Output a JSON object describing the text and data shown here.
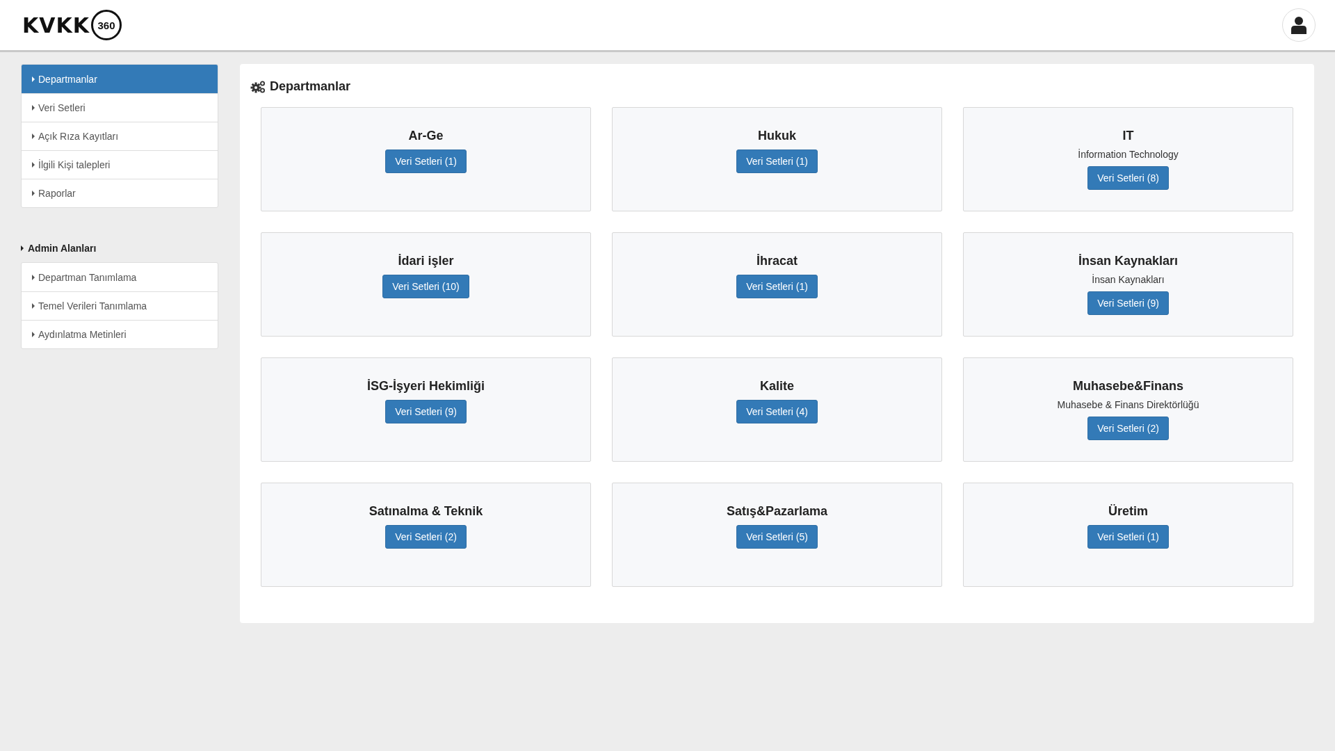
{
  "header": {
    "logo_text": "KVKK",
    "logo_number": "360"
  },
  "sidebar": {
    "items": [
      {
        "label": "Departmanlar",
        "selected": true
      },
      {
        "label": "Veri Setleri",
        "selected": false
      },
      {
        "label": "Açık Rıza Kayıtları",
        "selected": false
      },
      {
        "label": "İlgili Kişi talepleri",
        "selected": false
      },
      {
        "label": "Raporlar",
        "selected": false
      }
    ],
    "admin_title": "Admin Alanları",
    "admin_items": [
      {
        "label": "Departman Tanımlama",
        "selected": false
      },
      {
        "label": "Temel Verileri Tanımlama",
        "selected": false
      },
      {
        "label": "Aydınlatma Metinleri",
        "selected": false
      }
    ]
  },
  "main": {
    "title": "Departmanlar",
    "departments": [
      {
        "name": "Ar-Ge",
        "button": "Veri Setleri (1)"
      },
      {
        "name": "Hukuk",
        "button": "Veri Setleri (1)"
      },
      {
        "name": "IT",
        "description": "İnformation Technology",
        "button": "Veri Setleri (8)"
      },
      {
        "name": "İdari işler",
        "button": "Veri Setleri (10)"
      },
      {
        "name": "İhracat",
        "button": "Veri Setleri (1)"
      },
      {
        "name": "İnsan Kaynakları",
        "description": "İnsan Kaynakları",
        "button": "Veri Setleri (9)"
      },
      {
        "name": "İSG-İşyeri Hekimliği",
        "button": "Veri Setleri (9)"
      },
      {
        "name": "Kalite",
        "button": "Veri Setleri (4)"
      },
      {
        "name": "Muhasebe&Finans",
        "description": "Muhasebe & Finans Direktörlüğü",
        "button": "Veri Setleri (2)"
      },
      {
        "name": "Satınalma & Teknik",
        "button": "Veri Setleri (2)"
      },
      {
        "name": "Satış&Pazarlama",
        "button": "Veri Setleri (5)"
      },
      {
        "name": "Üretim",
        "button": "Veri Setleri (1)"
      }
    ]
  }
}
